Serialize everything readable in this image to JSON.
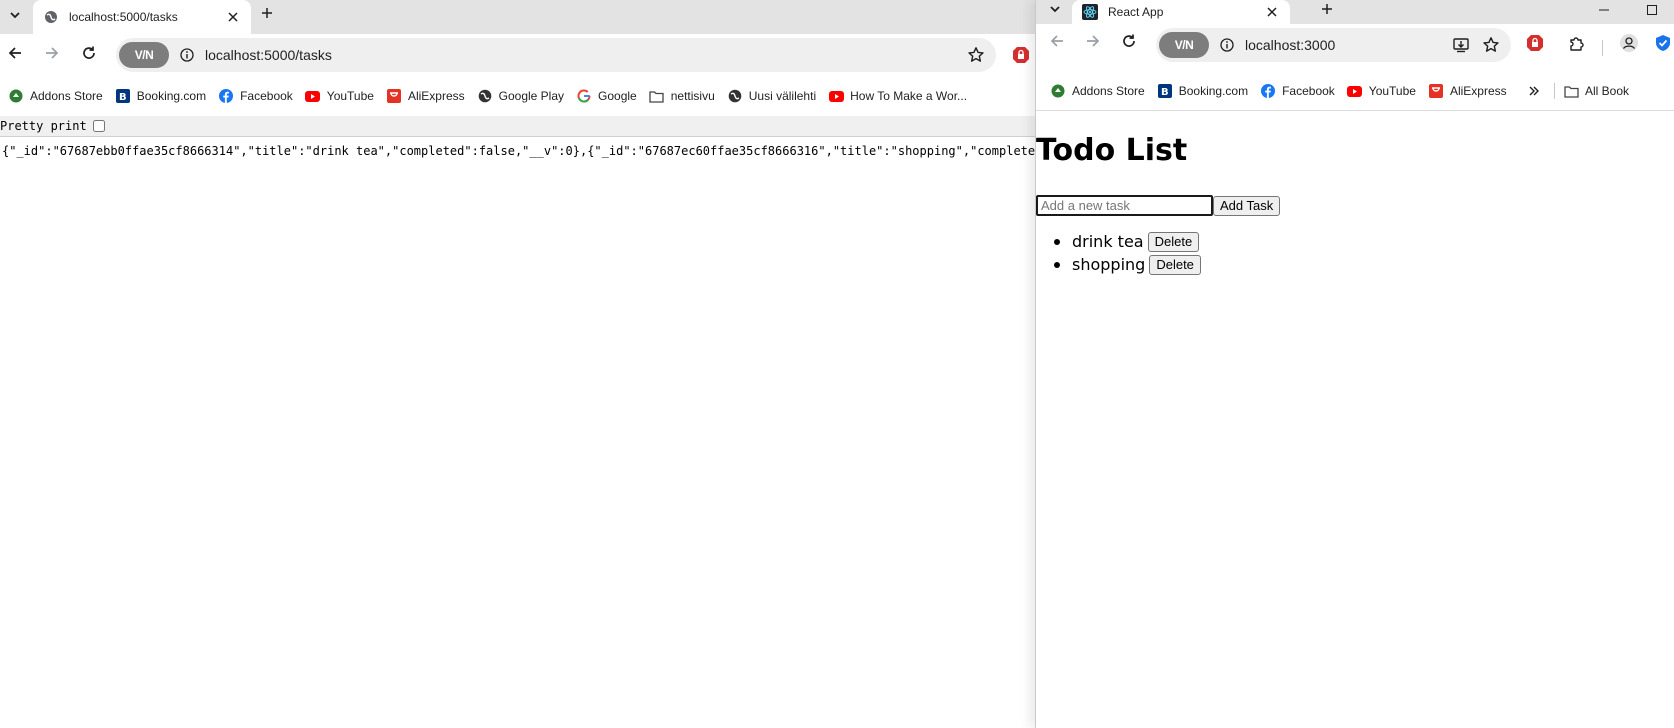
{
  "left_window": {
    "tab": {
      "title": "localhost:5000/tasks"
    },
    "omnibox": {
      "vpn_label": "V/N",
      "url": "localhost:5000/tasks"
    },
    "bookmarks": [
      {
        "label": "Addons Store",
        "icon": "addons-store-icon",
        "color": "#2e7d32"
      },
      {
        "label": "Booking.com",
        "icon": "booking-icon",
        "color": "#003580"
      },
      {
        "label": "Facebook",
        "icon": "facebook-icon",
        "color": "#1877f2"
      },
      {
        "label": "YouTube",
        "icon": "youtube-icon",
        "color": "#ff0000"
      },
      {
        "label": "AliExpress",
        "icon": "aliexpress-icon",
        "color": "#e43225"
      },
      {
        "label": "Google Play",
        "icon": "globe-icon",
        "color": "#333333"
      },
      {
        "label": "Google",
        "icon": "google-icon",
        "color": "#4285f4"
      },
      {
        "label": "nettisivu",
        "icon": "folder-icon",
        "color": "#444444"
      },
      {
        "label": "Uusi välilehti",
        "icon": "globe-icon",
        "color": "#333333"
      },
      {
        "label": "How To Make a Wor...",
        "icon": "youtube-icon",
        "color": "#ff0000"
      }
    ],
    "json_viewer": {
      "pretty_print_label": "Pretty print",
      "raw_text": "{\"_id\":\"67687ebb0ffae35cf8666314\",\"title\":\"drink tea\",\"completed\":false,\"__v\":0},{\"_id\":\"67687ec60ffae35cf8666316\",\"title\":\"shopping\",\"completed\""
    }
  },
  "right_window": {
    "tab": {
      "title": "React App"
    },
    "omnibox": {
      "vpn_label": "V/N",
      "url": "localhost:3000"
    },
    "bookmarks": [
      {
        "label": "Addons Store",
        "icon": "addons-store-icon",
        "color": "#2e7d32"
      },
      {
        "label": "Booking.com",
        "icon": "booking-icon",
        "color": "#003580"
      },
      {
        "label": "Facebook",
        "icon": "facebook-icon",
        "color": "#1877f2"
      },
      {
        "label": "YouTube",
        "icon": "youtube-icon",
        "color": "#ff0000"
      },
      {
        "label": "AliExpress",
        "icon": "aliexpress-icon",
        "color": "#e43225"
      }
    ],
    "all_bookmarks_label": "All Book",
    "app": {
      "heading": "Todo List",
      "input_placeholder": "Add a new task",
      "add_button": "Add Task",
      "tasks": [
        {
          "title": "drink tea",
          "delete_label": "Delete"
        },
        {
          "title": "shopping",
          "delete_label": "Delete"
        }
      ]
    }
  },
  "colors": {
    "tabstrip": "#e3e3e3",
    "omnibox": "#efefef",
    "vpn": "#7d7d7d",
    "accent_blue": "#0b57d0"
  }
}
